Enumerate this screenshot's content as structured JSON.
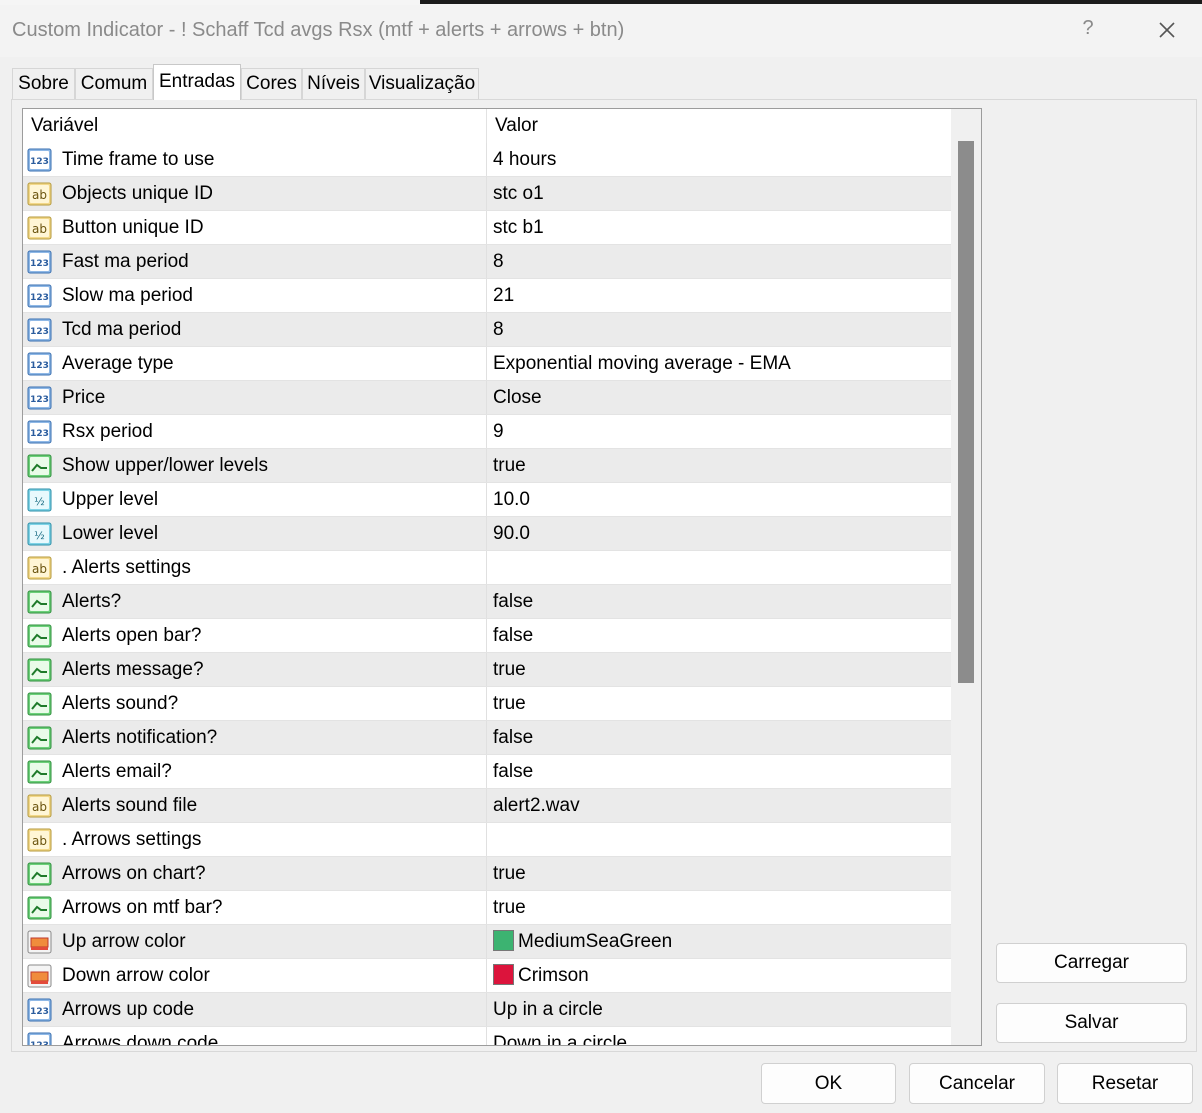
{
  "window": {
    "title": "Custom Indicator - ! Schaff Tcd avgs Rsx (mtf + alerts + arrows + btn)",
    "help_label": "?"
  },
  "tabs": [
    {
      "label": "Sobre"
    },
    {
      "label": "Comum"
    },
    {
      "label": "Entradas"
    },
    {
      "label": "Cores"
    },
    {
      "label": "Níveis"
    },
    {
      "label": "Visualização"
    }
  ],
  "active_tab": "Entradas",
  "grid": {
    "headers": {
      "variable": "Variável",
      "value": "Valor"
    },
    "rows": [
      {
        "icon": "int",
        "name": "Time frame to use",
        "value": "4 hours"
      },
      {
        "icon": "string",
        "name": "Objects unique ID",
        "value": "stc o1"
      },
      {
        "icon": "string",
        "name": "Button unique ID",
        "value": "stc b1"
      },
      {
        "icon": "int",
        "name": "Fast ma period",
        "value": "8"
      },
      {
        "icon": "int",
        "name": "Slow ma period",
        "value": "21"
      },
      {
        "icon": "int",
        "name": "Tcd ma period",
        "value": "8"
      },
      {
        "icon": "int",
        "name": "Average type",
        "value": "Exponential moving average - EMA"
      },
      {
        "icon": "int",
        "name": "Price",
        "value": "Close"
      },
      {
        "icon": "int",
        "name": "Rsx period",
        "value": "9"
      },
      {
        "icon": "bool",
        "name": "Show upper/lower levels",
        "value": "true"
      },
      {
        "icon": "double",
        "name": "Upper level",
        "value": "10.0"
      },
      {
        "icon": "double",
        "name": "Lower level",
        "value": "90.0"
      },
      {
        "icon": "string",
        "name": ". Alerts settings",
        "value": ""
      },
      {
        "icon": "bool",
        "name": "Alerts?",
        "value": "false"
      },
      {
        "icon": "bool",
        "name": "Alerts open bar?",
        "value": "false"
      },
      {
        "icon": "bool",
        "name": "Alerts message?",
        "value": "true"
      },
      {
        "icon": "bool",
        "name": "Alerts sound?",
        "value": "true"
      },
      {
        "icon": "bool",
        "name": "Alerts notification?",
        "value": "false"
      },
      {
        "icon": "bool",
        "name": "Alerts email?",
        "value": "false"
      },
      {
        "icon": "string",
        "name": "Alerts sound file",
        "value": "alert2.wav"
      },
      {
        "icon": "string",
        "name": ". Arrows settings",
        "value": ""
      },
      {
        "icon": "bool",
        "name": "Arrows on chart?",
        "value": "true"
      },
      {
        "icon": "bool",
        "name": "Arrows on mtf bar?",
        "value": "true"
      },
      {
        "icon": "color",
        "name": "Up arrow color",
        "value": "MediumSeaGreen",
        "swatch": "#3cb371"
      },
      {
        "icon": "color",
        "name": "Down arrow color",
        "value": "Crimson",
        "swatch": "#dc143c"
      },
      {
        "icon": "int",
        "name": "Arrows up code",
        "value": "Up in a circle"
      },
      {
        "icon": "int",
        "name": "Arrows down code",
        "value": "Down in a circle"
      }
    ]
  },
  "side_buttons": {
    "load": "Carregar",
    "save": "Salvar"
  },
  "bottom_buttons": {
    "ok": "OK",
    "cancel": "Cancelar",
    "reset": "Resetar"
  },
  "colors": {
    "title_text": "#8a8a8a",
    "row_alt": "#ebebeb",
    "scroll_thumb": "#8c8c8c"
  }
}
